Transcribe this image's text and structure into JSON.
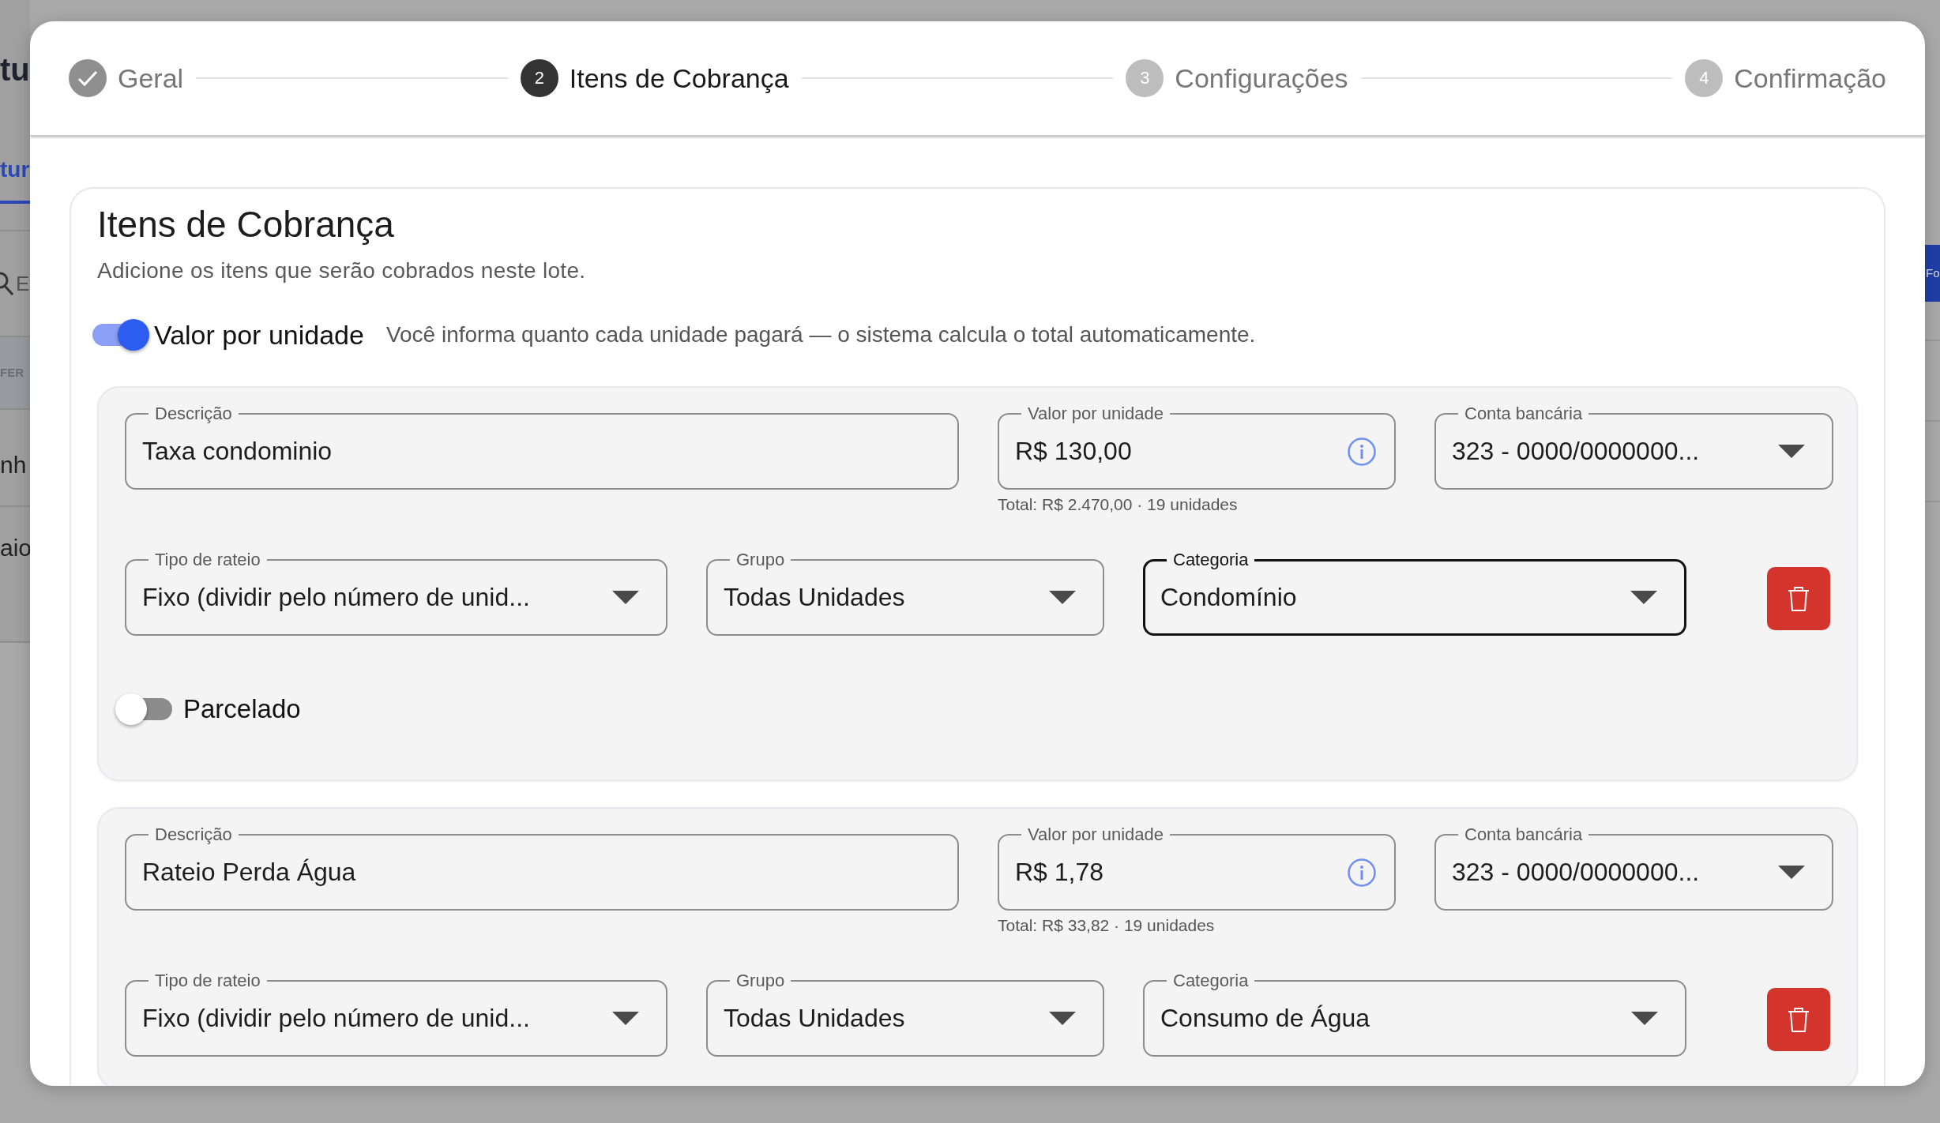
{
  "background_page": {
    "left_fragments": [
      {
        "kind": "heading",
        "text": "tu"
      },
      {
        "kind": "tab",
        "text": "tur",
        "selected": true
      },
      {
        "kind": "search",
        "text": "E"
      },
      {
        "kind": "column-header",
        "text": "FER"
      },
      {
        "kind": "row",
        "text": "nh"
      },
      {
        "kind": "row",
        "text": "aio"
      }
    ],
    "right_button": "Fo"
  },
  "stepper": {
    "steps": [
      {
        "label": "Geral",
        "completed": true,
        "active": false
      },
      {
        "number": "2",
        "label": "Itens de Cobrança",
        "completed": false,
        "active": true
      },
      {
        "number": "3",
        "label": "Configurações",
        "completed": false,
        "active": false
      },
      {
        "number": "4",
        "label": "Confirmação",
        "completed": false,
        "active": false
      }
    ]
  },
  "card": {
    "title": "Itens de Cobrança",
    "subtitle": "Adicione os itens que serão cobrados neste lote.",
    "unit_toggle": {
      "label": "Valor por unidade",
      "on": true,
      "hint": "Você informa quanto cada unidade pagará — o sistema calcula o total automaticamente."
    },
    "items": [
      {
        "top_fields": [
          {
            "kind": "text",
            "label": "Descrição",
            "value": "Taxa condominio",
            "focused": false
          },
          {
            "kind": "currency",
            "label": "Valor por unidade",
            "value": "R$ 130,00",
            "helper": "Total: R$ 2.470,00 · 19 unidades",
            "focused": false
          },
          {
            "kind": "select",
            "label": "Conta bancária",
            "value": "323 - 0000/0000000...",
            "focused": false
          }
        ],
        "bottom_fields": [
          {
            "kind": "select",
            "label": "Tipo de rateio",
            "value": "Fixo (dividir pelo número de unid...",
            "focused": false
          },
          {
            "kind": "select",
            "label": "Grupo",
            "value": "Todas Unidades",
            "focused": false
          },
          {
            "kind": "select",
            "label": "Categoria",
            "value": "Condomínio",
            "focused": true
          }
        ],
        "installments": {
          "label": "Parcelado",
          "on": false
        }
      },
      {
        "top_fields": [
          {
            "kind": "text",
            "label": "Descrição",
            "value": "Rateio Perda Água",
            "focused": false
          },
          {
            "kind": "currency",
            "label": "Valor por unidade",
            "value": "R$ 1,78",
            "helper": "Total: R$ 33,82 · 19 unidades",
            "focused": false
          },
          {
            "kind": "select",
            "label": "Conta bancária",
            "value": "323 - 0000/0000000...",
            "focused": false
          }
        ],
        "bottom_fields": [
          {
            "kind": "select",
            "label": "Tipo de rateio",
            "value": "Fixo (dividir pelo número de unid...",
            "focused": false
          },
          {
            "kind": "select",
            "label": "Grupo",
            "value": "Todas Unidades",
            "focused": false
          },
          {
            "kind": "select",
            "label": "Categoria",
            "value": "Consumo de Água",
            "focused": false
          }
        ]
      }
    ]
  }
}
